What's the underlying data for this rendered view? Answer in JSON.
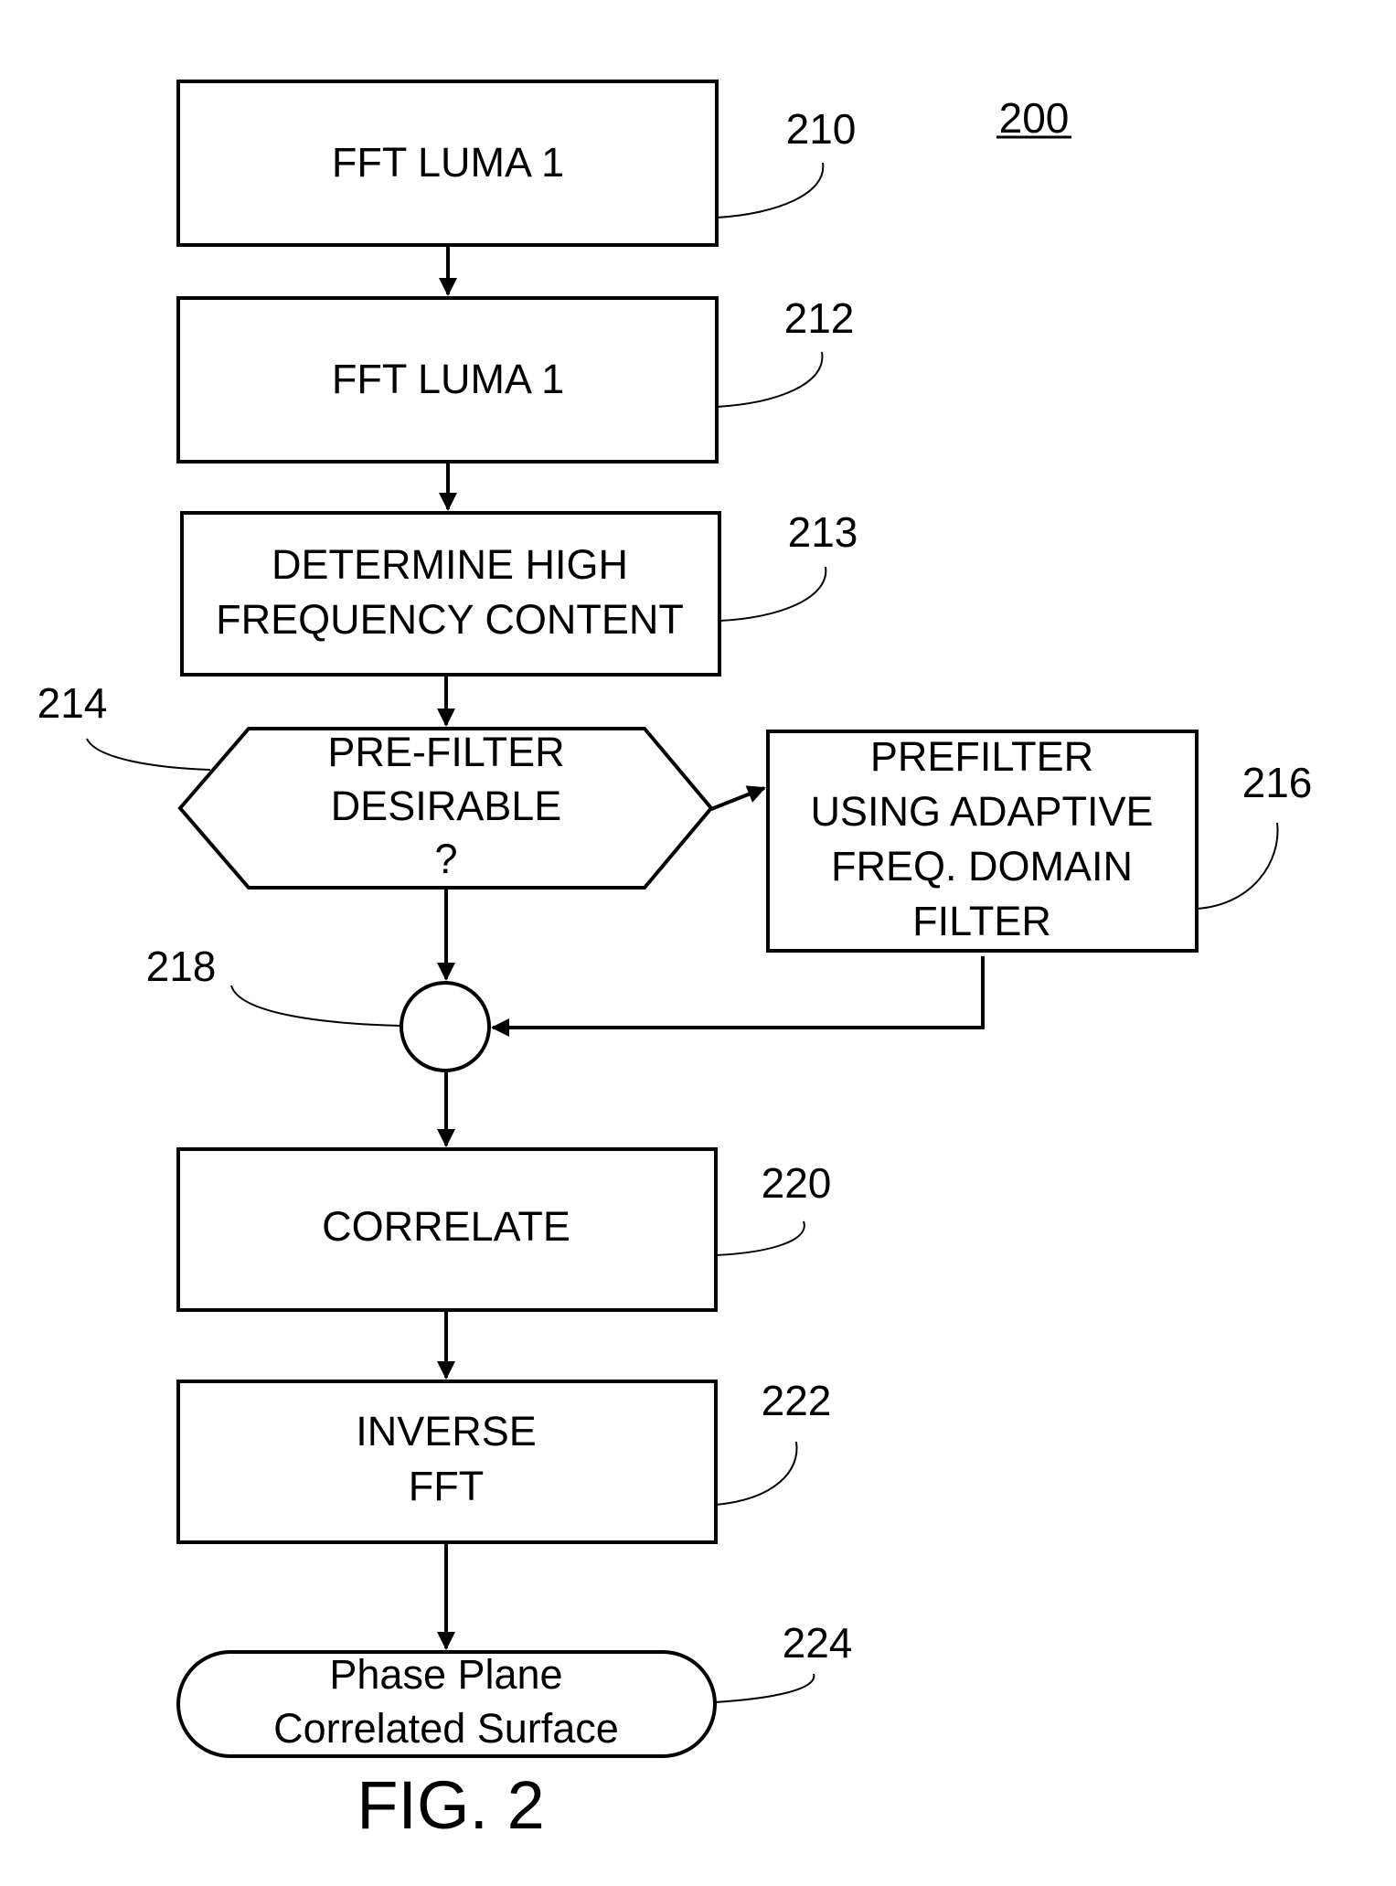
{
  "figure": {
    "number_label": "200",
    "caption": "FIG. 2"
  },
  "nodes": {
    "n210": {
      "ref": "210",
      "type": "process",
      "lines": [
        "FFT LUMA 1"
      ]
    },
    "n212": {
      "ref": "212",
      "type": "process",
      "lines": [
        "FFT LUMA 1"
      ]
    },
    "n213": {
      "ref": "213",
      "type": "process",
      "lines": [
        "DETERMINE HIGH",
        "FREQUENCY CONTENT"
      ]
    },
    "n214": {
      "ref": "214",
      "type": "decision",
      "lines": [
        "PRE-FILTER",
        "DESIRABLE",
        "?"
      ]
    },
    "n216": {
      "ref": "216",
      "type": "process",
      "lines": [
        "PREFILTER",
        "USING ADAPTIVE",
        "FREQ. DOMAIN",
        "FILTER"
      ]
    },
    "n218": {
      "ref": "218",
      "type": "junction",
      "lines": []
    },
    "n220": {
      "ref": "220",
      "type": "process",
      "lines": [
        "CORRELATE"
      ]
    },
    "n222": {
      "ref": "222",
      "type": "process",
      "lines": [
        "INVERSE",
        "FFT"
      ]
    },
    "n224": {
      "ref": "224",
      "type": "terminal",
      "lines": [
        "Phase Plane",
        "Correlated Surface"
      ]
    }
  },
  "edges": [
    {
      "from": "210",
      "to": "212"
    },
    {
      "from": "212",
      "to": "213"
    },
    {
      "from": "213",
      "to": "214"
    },
    {
      "from": "214",
      "to": "216"
    },
    {
      "from": "214",
      "to": "218"
    },
    {
      "from": "216",
      "to": "218"
    },
    {
      "from": "218",
      "to": "220"
    },
    {
      "from": "220",
      "to": "222"
    },
    {
      "from": "222",
      "to": "224"
    }
  ],
  "colors": {
    "ink": "#000000",
    "paper": "#ffffff"
  }
}
